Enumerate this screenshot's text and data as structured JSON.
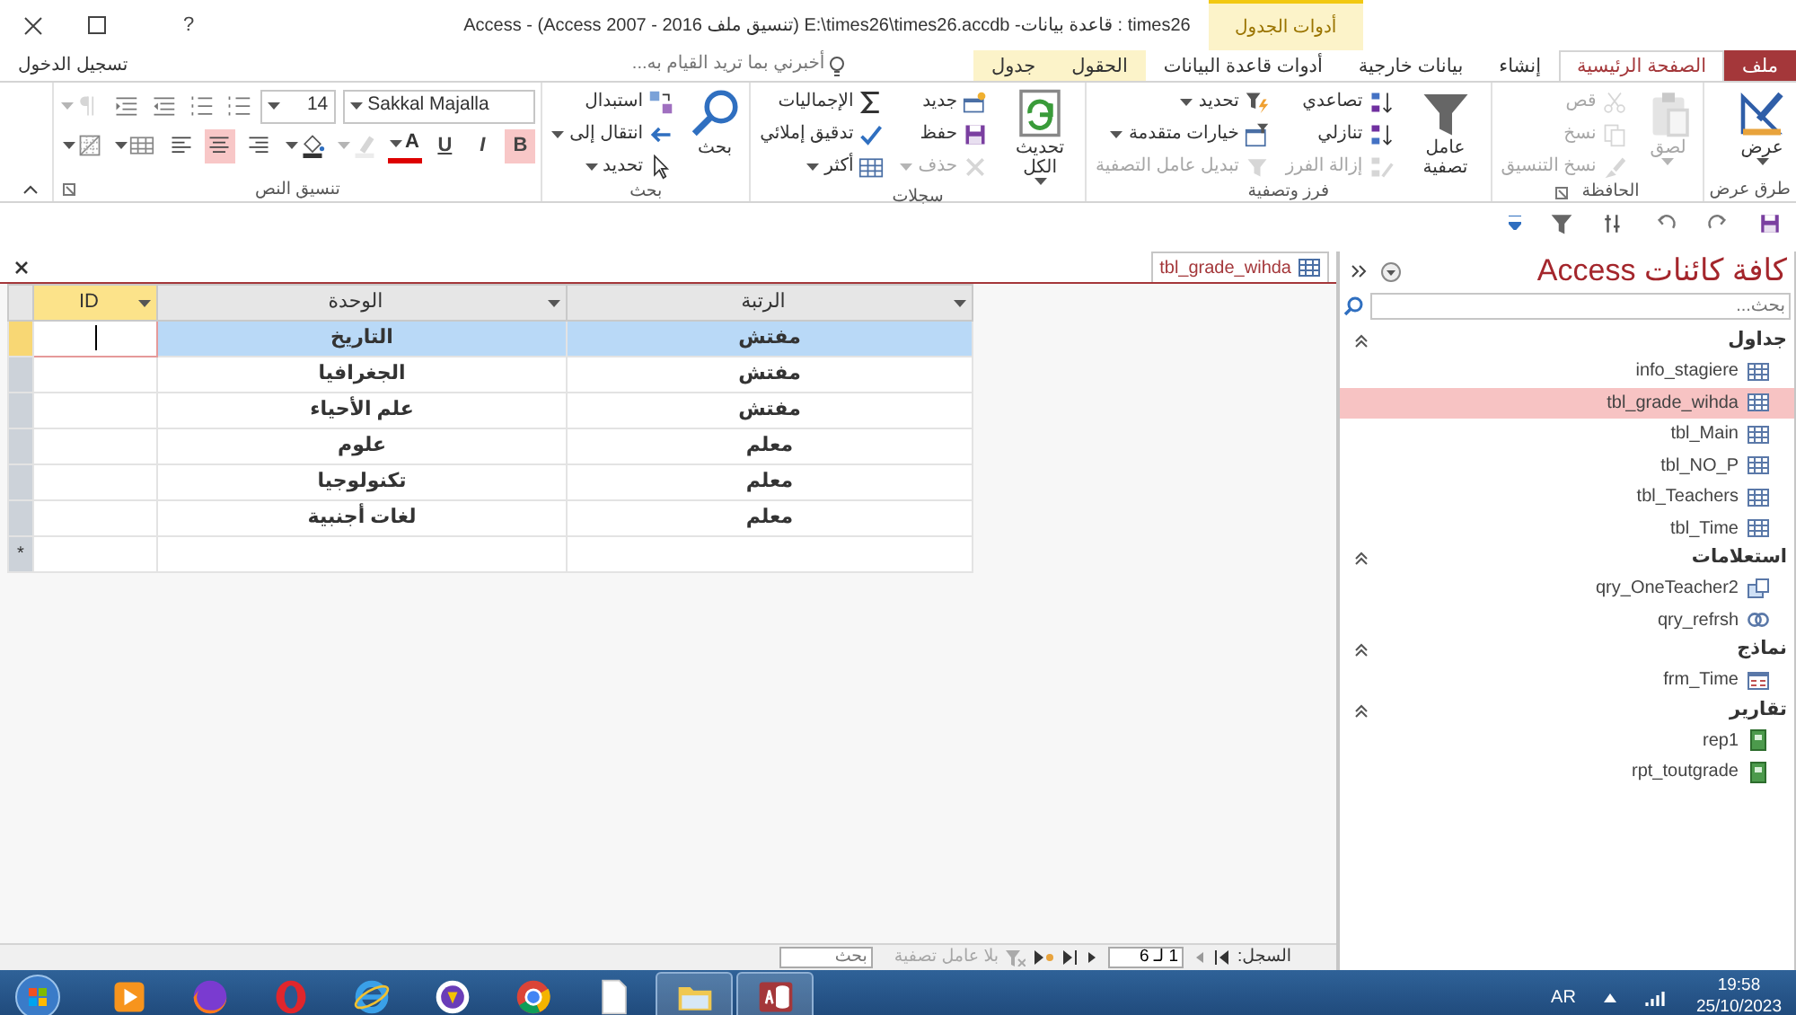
{
  "window": {
    "title": "times26 : قاعدة بيانات- E:\\times26\\times26.accdb (تنسيق ملف Access 2007 - 2016) - Access",
    "help": "?",
    "contextual_group": "أدوات الجدول"
  },
  "tabs": [
    {
      "label": "ملف",
      "selected": false,
      "kind": "file"
    },
    {
      "label": "الصفحة الرئيسية",
      "selected": true,
      "kind": "normal"
    },
    {
      "label": "إنشاء",
      "selected": false,
      "kind": "normal"
    },
    {
      "label": "بيانات خارجية",
      "selected": false,
      "kind": "normal"
    },
    {
      "label": "أدوات قاعدة البيانات",
      "selected": false,
      "kind": "normal"
    },
    {
      "label": "الحقول",
      "selected": false,
      "kind": "contextual"
    },
    {
      "label": "جدول",
      "selected": false,
      "kind": "contextual"
    }
  ],
  "tell_me": {
    "placeholder": "أخبرني بما تريد القيام به..."
  },
  "sign_in": "تسجيل الدخول",
  "ribbon_groups": [
    {
      "label": "طرق عرض",
      "items": [
        {
          "label": "عرض",
          "kind": "large",
          "disabled": false,
          "dropdown": true
        }
      ]
    },
    {
      "label": "الحافظة",
      "launcher": true,
      "items": [
        {
          "label": "لصق",
          "kind": "large",
          "disabled": true,
          "dropdown": true
        },
        {
          "label": "قص",
          "kind": "small",
          "disabled": true,
          "dropdown": false
        },
        {
          "label": "نسخ",
          "kind": "small",
          "disabled": true,
          "dropdown": false
        },
        {
          "label": "نسخ التنسيق",
          "kind": "small",
          "disabled": true,
          "dropdown": false
        }
      ]
    },
    {
      "label": "فرز وتصفية",
      "items": [
        {
          "label": "عامل تصفية",
          "kind": "large",
          "disabled": false,
          "dropdown": false
        },
        {
          "label": "تصاعدي",
          "kind": "small",
          "disabled": false,
          "dropdown": false
        },
        {
          "label": "تنازلي",
          "kind": "small",
          "disabled": false,
          "dropdown": false
        },
        {
          "label": "إزالة الفرز",
          "kind": "small",
          "disabled": true,
          "dropdown": false
        },
        {
          "label": "تحديد",
          "kind": "small",
          "disabled": false,
          "dropdown": true
        },
        {
          "label": "خيارات متقدمة",
          "kind": "small",
          "disabled": false,
          "dropdown": true
        },
        {
          "label": "تبديل عامل التصفية",
          "kind": "small",
          "disabled": true,
          "dropdown": false
        }
      ]
    },
    {
      "label": "سجلات",
      "items": [
        {
          "label": "تحديث الكل",
          "kind": "large",
          "disabled": false,
          "dropdown": true
        },
        {
          "label": "جديد",
          "kind": "small",
          "disabled": false,
          "dropdown": false
        },
        {
          "label": "حفظ",
          "kind": "small",
          "disabled": false,
          "dropdown": false
        },
        {
          "label": "حذف",
          "kind": "small",
          "disabled": true,
          "dropdown": true
        },
        {
          "label": "الإجماليات",
          "kind": "small",
          "disabled": false,
          "dropdown": false
        },
        {
          "label": "تدقيق إملائي",
          "kind": "small",
          "disabled": false,
          "dropdown": false
        },
        {
          "label": "أكثر",
          "kind": "small",
          "disabled": false,
          "dropdown": true
        }
      ]
    },
    {
      "label": "بحث",
      "items": [
        {
          "label": "بحث",
          "kind": "large",
          "disabled": false,
          "dropdown": false
        },
        {
          "label": "استبدال",
          "kind": "small",
          "disabled": false,
          "dropdown": false
        },
        {
          "label": "انتقال إلى",
          "kind": "small",
          "disabled": false,
          "dropdown": true
        },
        {
          "label": "تحديد",
          "kind": "small",
          "disabled": false,
          "dropdown": true
        }
      ]
    }
  ],
  "text_formatting": {
    "label": "تنسيق النص",
    "launcher": true,
    "font_name": "Sakkal Majalla",
    "font_size": "14",
    "row_1": [
      {
        "on": false,
        "disabled": false,
        "dropdown": false
      },
      {
        "on": false,
        "disabled": false,
        "dropdown": false
      },
      {
        "on": false,
        "disabled": false,
        "dropdown": false
      },
      {
        "on": false,
        "disabled": false,
        "dropdown": false
      },
      {
        "on": false,
        "disabled": true,
        "dropdown": true
      }
    ],
    "row_2": [
      {
        "label": "B",
        "on": true,
        "disabled": false,
        "dropdown": false
      },
      {
        "label": "I",
        "on": false,
        "disabled": false,
        "dropdown": false
      },
      {
        "label": "U",
        "on": false,
        "disabled": false,
        "dropdown": false
      },
      {
        "label": "A",
        "on": false,
        "disabled": false,
        "dropdown": true
      },
      {
        "on": false,
        "disabled": true,
        "dropdown": true
      },
      {
        "on": false,
        "disabled": false,
        "dropdown": true
      },
      {
        "on": false,
        "disabled": false,
        "dropdown": false
      },
      {
        "on": true,
        "disabled": false,
        "dropdown": false
      },
      {
        "on": false,
        "disabled": false,
        "dropdown": false
      },
      {
        "on": false,
        "disabled": false,
        "dropdown": true
      },
      {
        "on": false,
        "disabled": false,
        "dropdown": true
      }
    ]
  },
  "document_tab": {
    "label": "tbl_grade_wihda"
  },
  "table": {
    "columns": [
      {
        "label": "الرتبة",
        "selected": false
      },
      {
        "label": "الوحدة",
        "selected": false
      },
      {
        "label": "ID",
        "selected": true
      }
    ],
    "rows": [
      {
        "selected": true,
        "unit": "التاريخ",
        "rank": "مفتش"
      },
      {
        "selected": false,
        "unit": "الجغرافيا",
        "rank": "مفتش"
      },
      {
        "selected": false,
        "unit": "علم الأحياء",
        "rank": "مفتش"
      },
      {
        "selected": false,
        "unit": "علوم",
        "rank": "معلم"
      },
      {
        "selected": false,
        "unit": "تكنولوجيا",
        "rank": "معلم"
      },
      {
        "selected": false,
        "unit": "لغات أجنبية",
        "rank": "معلم"
      }
    ],
    "new_row_marker": "*"
  },
  "status_bar": {
    "record_label": "السجل:",
    "record_position": "1 لـ 6",
    "filter_label": "بلا عامل تصفية",
    "search_placeholder": "بحث"
  },
  "navigation_pane": {
    "title": "كافة كائنات Access",
    "search_placeholder": "بحث...",
    "groups": [
      {
        "label": "جداول",
        "expanded": true,
        "items": [
          {
            "label": "info_stagiere",
            "kind": "table",
            "selected": false
          },
          {
            "label": "tbl_grade_wihda",
            "kind": "table",
            "selected": true
          },
          {
            "label": "tbl_Main",
            "kind": "table",
            "selected": false
          },
          {
            "label": "tbl_NO_P",
            "kind": "table",
            "selected": false
          },
          {
            "label": "tbl_Teachers",
            "kind": "table",
            "selected": false
          },
          {
            "label": "tbl_Time",
            "kind": "table",
            "selected": false
          }
        ]
      },
      {
        "label": "استعلامات",
        "expanded": true,
        "items": [
          {
            "label": "qry_OneTeacher2",
            "kind": "query",
            "selected": false
          },
          {
            "label": "qry_refrsh",
            "kind": "union_query",
            "selected": false
          }
        ]
      },
      {
        "label": "نماذج",
        "expanded": true,
        "items": [
          {
            "label": "frm_Time",
            "kind": "form",
            "selected": false
          }
        ]
      },
      {
        "label": "تقارير",
        "expanded": true,
        "items": [
          {
            "label": "rep1",
            "kind": "report",
            "selected": false
          },
          {
            "label": "rpt_toutgrade",
            "kind": "report",
            "selected": false
          }
        ]
      }
    ]
  },
  "taskbar": {
    "apps": [
      {
        "open": false
      },
      {
        "open": false
      },
      {
        "open": false
      },
      {
        "open": false
      },
      {
        "open": false
      },
      {
        "open": false
      },
      {
        "open": false
      },
      {
        "open": true
      },
      {
        "open": true
      }
    ],
    "language": "AR",
    "time": "19:58",
    "date": "25/10/2023"
  }
}
